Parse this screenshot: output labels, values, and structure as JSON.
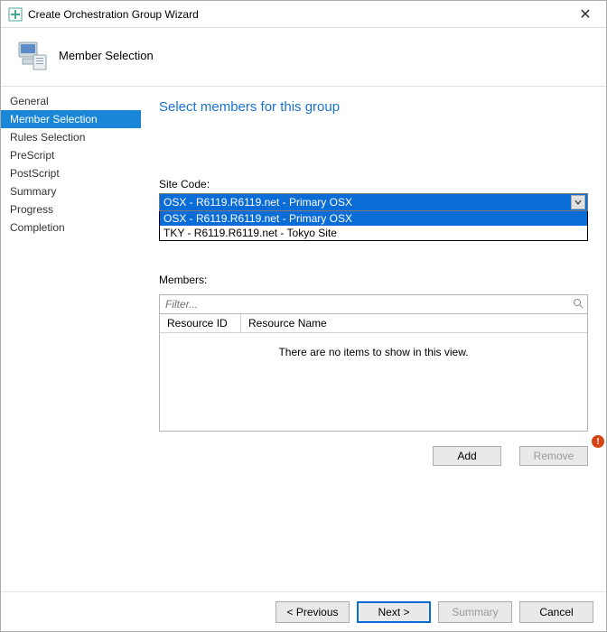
{
  "window": {
    "title": "Create Orchestration Group Wizard",
    "close_glyph": "✕"
  },
  "header": {
    "title": "Member Selection"
  },
  "sidebar": {
    "items": [
      {
        "label": "General",
        "selected": false
      },
      {
        "label": "Member Selection",
        "selected": true
      },
      {
        "label": "Rules Selection",
        "selected": false
      },
      {
        "label": "PreScript",
        "selected": false
      },
      {
        "label": "PostScript",
        "selected": false
      },
      {
        "label": "Summary",
        "selected": false
      },
      {
        "label": "Progress",
        "selected": false
      },
      {
        "label": "Completion",
        "selected": false
      }
    ]
  },
  "main": {
    "page_title": "Select members for this group",
    "site_code_label": "Site Code:",
    "site_code_selected": "OSX - R6119.R6119.net - Primary OSX",
    "site_code_options": [
      {
        "label": "OSX - R6119.R6119.net - Primary OSX",
        "highlighted": true
      },
      {
        "label": "TKY - R6119.R6119.net - Tokyo Site",
        "highlighted": false
      }
    ],
    "members_label": "Members:",
    "filter_placeholder": "Filter...",
    "grid": {
      "columns": [
        "Resource ID",
        "Resource Name"
      ],
      "empty_text": "There are no items to show in this view."
    },
    "add_label": "Add",
    "remove_label": "Remove",
    "warning_glyph": "!"
  },
  "footer": {
    "previous": "< Previous",
    "next": "Next >",
    "summary": "Summary",
    "cancel": "Cancel"
  }
}
